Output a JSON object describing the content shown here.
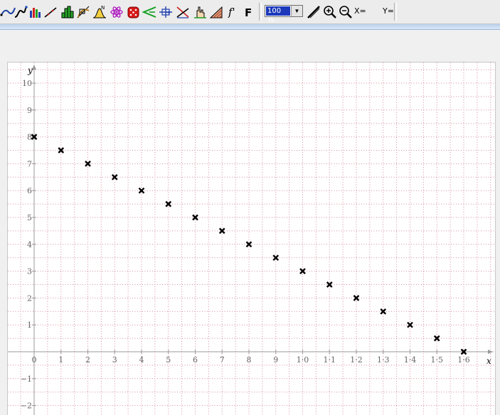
{
  "toolbar": {
    "tools": [
      {
        "name": "line-curve-tool-icon",
        "icon": "curve"
      },
      {
        "name": "function-graph-tool-icon",
        "icon": "s-curve"
      },
      {
        "name": "bar-chart-tool-icon",
        "icon": "bars"
      },
      {
        "name": "straight-line-tool-icon",
        "icon": "diagonal-line"
      },
      {
        "name": "histogram-tool-icon",
        "icon": "histogram"
      },
      {
        "name": "cobweb-tool-icon",
        "icon": "cobweb"
      },
      {
        "name": "normal-distribution-tool-icon",
        "icon": "bell-curve"
      },
      {
        "name": "atom-tool-icon",
        "icon": "atom"
      },
      {
        "name": "dice-tool-icon",
        "icon": "die"
      },
      {
        "name": "angle-tool-icon",
        "icon": "angle"
      },
      {
        "name": "number-line-tool-icon",
        "icon": "number-line"
      },
      {
        "name": "intersection-tool-icon",
        "icon": "crossing-lines"
      },
      {
        "name": "hand-point-tool-icon",
        "icon": "hand"
      },
      {
        "name": "area-shading-tool-icon",
        "icon": "shading"
      },
      {
        "name": "derivative-tool-icon",
        "icon": "f-prime"
      },
      {
        "name": "antiderivative-tool-icon",
        "icon": "F"
      }
    ],
    "derivative_label": "f'",
    "antiderivative_label": "F",
    "zoom": {
      "value": "100 %"
    },
    "readout": {
      "x_label": "X=",
      "y_label": "Y="
    },
    "colors": {
      "accent_blue": "#1c39bb",
      "toolbar": "#ececec",
      "grid_dots": "#d48a9a"
    }
  },
  "chart_data": {
    "type": "scatter",
    "marker": "x",
    "x": [
      0,
      1,
      2,
      3,
      4,
      5,
      6,
      7,
      8,
      9,
      10,
      11,
      12,
      13,
      14,
      15,
      16
    ],
    "y": [
      8,
      7.5,
      7,
      6.5,
      6,
      5.5,
      5,
      4.5,
      4,
      3.5,
      3,
      2.5,
      2,
      1.5,
      1,
      0.5,
      0
    ],
    "xlabel": "x",
    "ylabel": "y",
    "xticks": [
      0,
      1,
      2,
      3,
      4,
      5,
      6,
      7,
      8,
      9,
      10,
      11,
      12,
      13,
      14,
      15,
      16
    ],
    "xtick_labels": [
      "0",
      "1",
      "2",
      "3",
      "4",
      "5",
      "6",
      "7",
      "8",
      "9",
      "1·0",
      "1·1",
      "1·2",
      "1·3",
      "1·4",
      "1·5",
      "1·6"
    ],
    "yticks": [
      -2,
      -1,
      1,
      2,
      3,
      4,
      5,
      6,
      7,
      8,
      9,
      10
    ],
    "ytick_labels": [
      "−2",
      "−1",
      "1",
      "2",
      "3",
      "4",
      "5",
      "6",
      "7",
      "8",
      "9",
      "10"
    ],
    "xlim": [
      -1,
      17
    ],
    "ylim": [
      -2.2,
      10.5
    ],
    "grid": true,
    "grid_minor_per_unit": 2
  }
}
